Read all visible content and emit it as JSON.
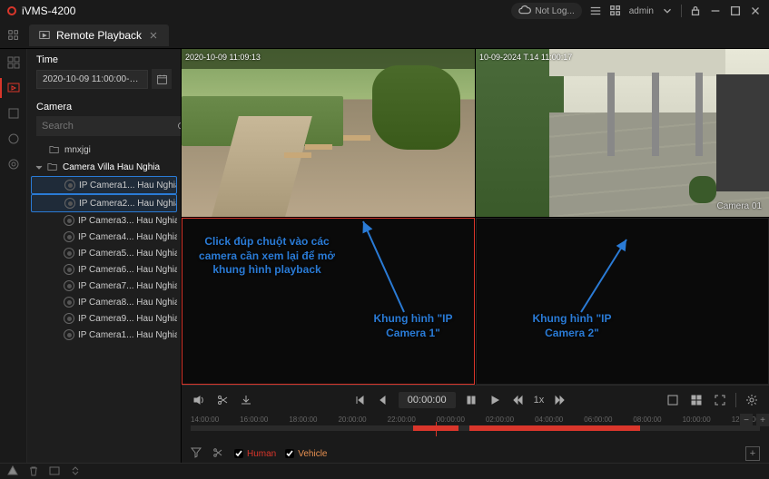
{
  "app": {
    "title": "iVMS-4200"
  },
  "titlebar": {
    "notlog": "Not Log...",
    "user": "admin"
  },
  "tab": {
    "label": "Remote Playback"
  },
  "sidebar": {
    "time_label": "Time",
    "time_value": "2020-10-09 11:00:00-2020-1...",
    "camera_label": "Camera",
    "search_placeholder": "Search",
    "folder1": "mnxjgi",
    "group": "Camera Villa Hau Nghia",
    "cameras": [
      "IP Camera1... Hau Nghia",
      "IP Camera2... Hau Nghia",
      "IP Camera3... Hau Nghia",
      "IP Camera4... Hau Nghia",
      "IP Camera5... Hau Nghia",
      "IP Camera6... Hau Nghia",
      "IP Camera7... Hau Nghia",
      "IP Camera8... Hau Nghia",
      "IP Camera9... Hau Nghia",
      "IP Camera1... Hau Nghia"
    ]
  },
  "feeds": {
    "ts1": "2020-10-09 11:09:13",
    "ts2": "10-09-2024 T.14 11:00:17",
    "cam2": "Camera 01"
  },
  "annotations": {
    "tip": "Click đúp chuột vào các camera cần xem lại để mở khung hình playback",
    "frame1": "Khung hình \"IP Camera 1\"",
    "frame2": "Khung hình \"IP Camera 2\""
  },
  "controls": {
    "time": "00:00:00",
    "speed": "1x"
  },
  "timeline": {
    "marks": [
      "14:00:00",
      "16:00:00",
      "18:00:00",
      "20:00:00",
      "22:00:00",
      "00:00:00",
      "02:00:00",
      "04:00:00",
      "06:00:00",
      "08:00:00",
      "10:00:00",
      "12:00:00"
    ]
  },
  "filter": {
    "human": "Human",
    "vehicle": "Vehicle"
  }
}
